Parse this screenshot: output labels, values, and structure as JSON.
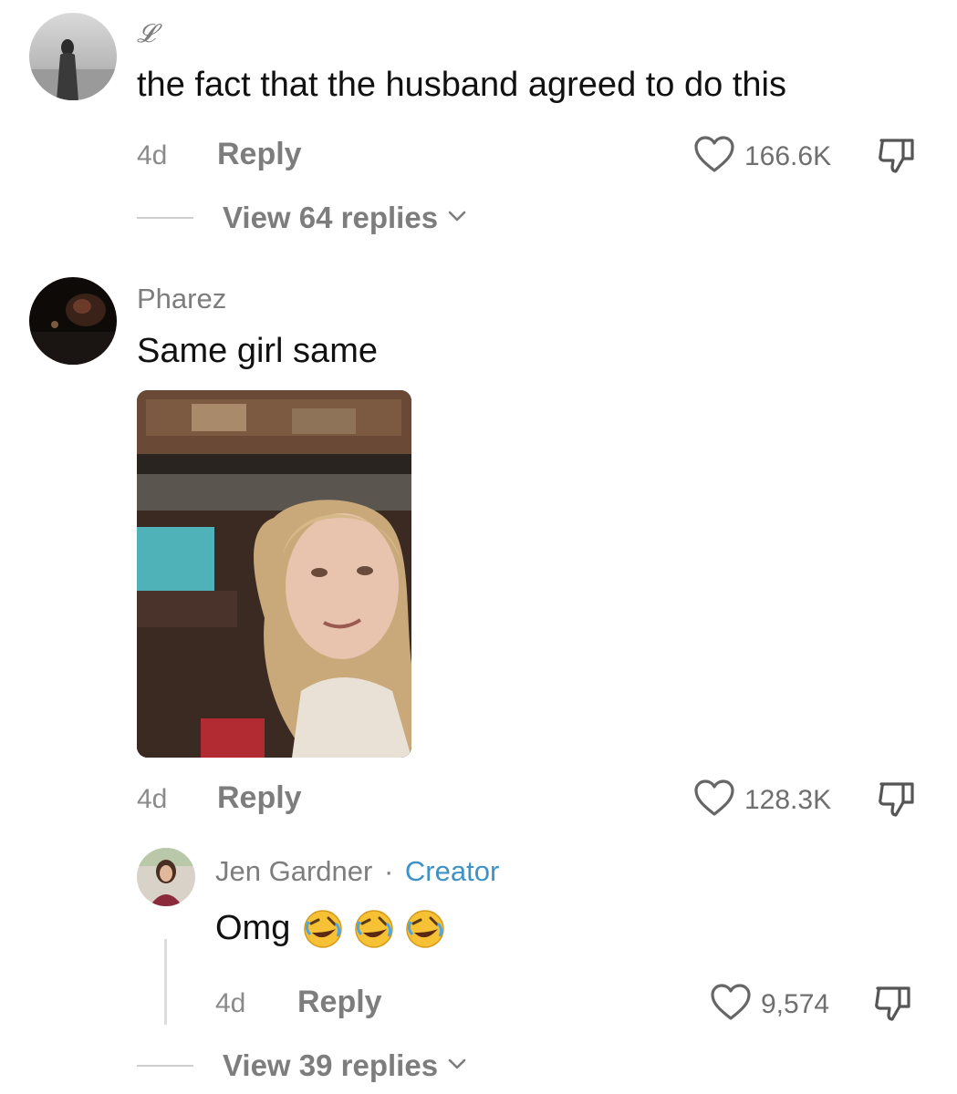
{
  "comments": [
    {
      "username": "𝓛",
      "text": "the fact that the husband agreed to do this",
      "time": "4d",
      "reply_label": "Reply",
      "likes": "166.6K",
      "view_replies": "View 64 replies"
    },
    {
      "username": "Pharez",
      "text": "Same girl same",
      "time": "4d",
      "reply_label": "Reply",
      "likes": "128.3K",
      "reply": {
        "username": "Jen Gardner",
        "separator": "·",
        "badge": "Creator",
        "text": "Omg",
        "emoji_count": 3,
        "time": "4d",
        "reply_label": "Reply",
        "likes": "9,574"
      },
      "view_replies": "View 39 replies"
    }
  ],
  "colors": {
    "creator": "#3f92c4",
    "meta": "#7d7d7d"
  }
}
